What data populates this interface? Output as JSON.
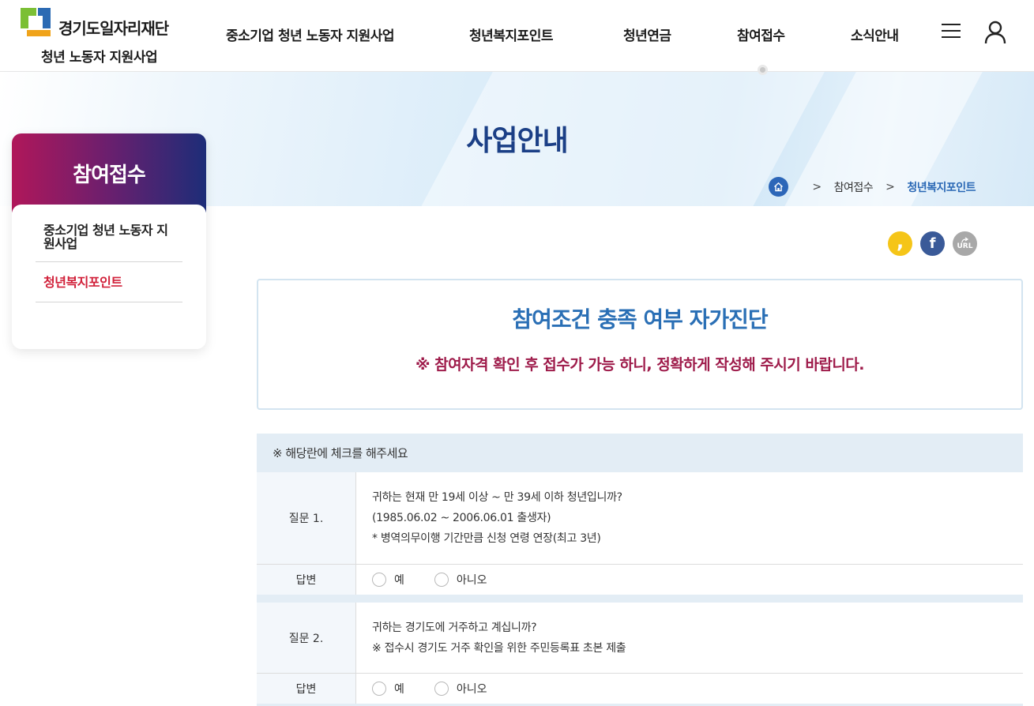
{
  "header": {
    "org_name": "경기도일자리재단",
    "site_name": "청년 노동자 지원사업",
    "nav": [
      "중소기업 청년 노동자 지원사업",
      "청년복지포인트",
      "청년연금",
      "참여접수",
      "소식안내"
    ],
    "menu_icon": "hamburger-menu-icon",
    "user_icon": "user-icon",
    "logo_colors": [
      "#2b6ab3",
      "#7bbf35",
      "#f0a31a"
    ]
  },
  "banner": {
    "title": "사업안내",
    "breadcrumb": [
      "참여접수",
      "청년복지포인트"
    ],
    "home_icon": "home-icon"
  },
  "sidebar": {
    "title": "참여접수",
    "items": [
      {
        "label": "중소기업 청년 노동자 지원사업"
      },
      {
        "label": "청년복지포인트"
      }
    ]
  },
  "share": {
    "kakao_glyph": ",",
    "facebook_glyph": "f",
    "url_label": "URL"
  },
  "notice": {
    "title": "참여조건 충족 여부 자가진단",
    "warning": "※ 참여자격 확인 후 접수가 가능 하니, 정확하게 작성해 주시기 바랍니다."
  },
  "form": {
    "instruction": "※ 해당란에 체크를 해주세요",
    "answer_label": "답변",
    "questions": [
      {
        "label": "질문 1.",
        "lines": [
          "귀하는 현재 만 19세 이상 ~ 만 39세 이하 청년입니까?",
          "(1985.06.02 ~ 2006.06.01 출생자)",
          "* 병역의무이행 기간만큼 신청 연령 연장(최고 3년)"
        ],
        "options": [
          "예",
          "아니오"
        ]
      },
      {
        "label": "질문 2.",
        "lines": [
          "귀하는 경기도에 거주하고 계십니까?",
          "※ 접수시 경기도 거주 확인을 위한 주민등록표 초본 제출"
        ],
        "options": [
          "예",
          "아니오"
        ]
      }
    ]
  }
}
